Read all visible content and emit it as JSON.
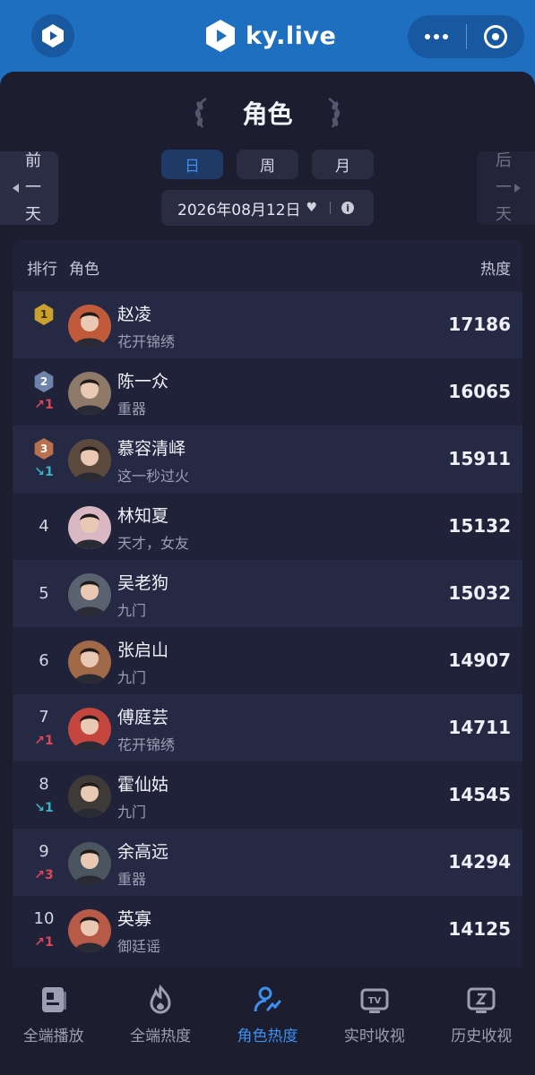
{
  "app": {
    "brand_name": "ky.live",
    "top_left_icon": "play-logo-icon",
    "menu_icon": "more-dots-icon",
    "close_icon": "target-circle-icon",
    "accent_color": "#1f6fc0"
  },
  "page": {
    "title": "角色",
    "prev_day_label": "前一天",
    "next_day_label": "后一天",
    "periods": [
      "日",
      "周",
      "月"
    ],
    "active_period": "日",
    "date": "2026年08月12日",
    "date_dropdown_icon": "heart-icon",
    "info_icon": "info-icon"
  },
  "table": {
    "headers": {
      "rank": "排行",
      "role": "角色",
      "heat": "热度"
    },
    "rows": [
      {
        "rank": "1",
        "medal": "gold",
        "change": "",
        "change_dir": "",
        "name": "赵凌",
        "show": "花开锦绣",
        "heat": "17186"
      },
      {
        "rank": "2",
        "medal": "silver",
        "change": "1",
        "change_dir": "up",
        "name": "陈一众",
        "show": "重器",
        "heat": "16065"
      },
      {
        "rank": "3",
        "medal": "bronze",
        "change": "1",
        "change_dir": "down",
        "name": "慕容清峄",
        "show": "这一秒过火",
        "heat": "15911"
      },
      {
        "rank": "4",
        "medal": "",
        "change": "",
        "change_dir": "",
        "name": "林知夏",
        "show": "天才，女友",
        "heat": "15132"
      },
      {
        "rank": "5",
        "medal": "",
        "change": "",
        "change_dir": "",
        "name": "吴老狗",
        "show": "九门",
        "heat": "15032"
      },
      {
        "rank": "6",
        "medal": "",
        "change": "",
        "change_dir": "",
        "name": "张启山",
        "show": "九门",
        "heat": "14907"
      },
      {
        "rank": "7",
        "medal": "",
        "change": "1",
        "change_dir": "up",
        "name": "傅庭芸",
        "show": "花开锦绣",
        "heat": "14711"
      },
      {
        "rank": "8",
        "medal": "",
        "change": "1",
        "change_dir": "down",
        "name": "霍仙姑",
        "show": "九门",
        "heat": "14545"
      },
      {
        "rank": "9",
        "medal": "",
        "change": "3",
        "change_dir": "up",
        "name": "余高远",
        "show": "重器",
        "heat": "14294"
      },
      {
        "rank": "10",
        "medal": "",
        "change": "1",
        "change_dir": "up",
        "name": "英寡",
        "show": "御廷谣",
        "heat": "14125"
      }
    ]
  },
  "nav": {
    "items": [
      {
        "label": "全端播放",
        "icon": "play-book-icon"
      },
      {
        "label": "全端热度",
        "icon": "flame-icon"
      },
      {
        "label": "角色热度",
        "icon": "user-chart-icon"
      },
      {
        "label": "实时收视",
        "icon": "tv-icon"
      },
      {
        "label": "历史收视",
        "icon": "history-tv-icon"
      }
    ],
    "active_label": "角色热度"
  }
}
